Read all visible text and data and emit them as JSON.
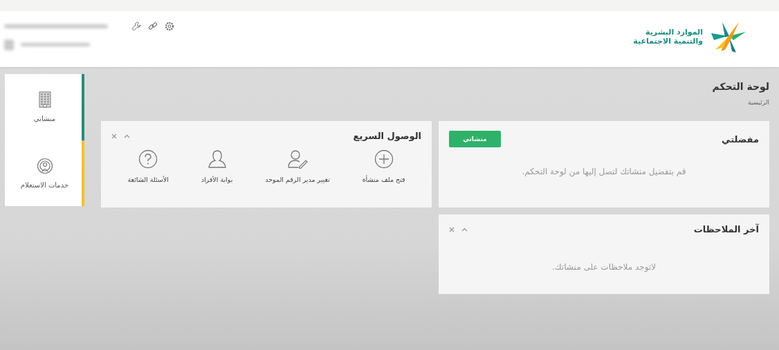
{
  "header": {
    "logo_lines": [
      "الموارد البشرية",
      "والتنمية الاجتماعية"
    ]
  },
  "sidebar": {
    "items": [
      {
        "label": "منشاتي",
        "kind": "building",
        "color": "#2a8a80"
      },
      {
        "label": "خدمات الاستعلام",
        "kind": "broadcast",
        "color": "#f2c230"
      }
    ]
  },
  "page": {
    "title": "لوحة التحكم",
    "breadcrumb": "الرئيسية"
  },
  "favorites": {
    "title": "مفضلتي",
    "button": "منشاتي",
    "empty_text": "قم بتفضيل منشاتك لتصل إليها من لوحة التحكم."
  },
  "notes": {
    "title": "آخر الملاحظات",
    "empty_text": "لاتوجد ملاحظات على منشاتك."
  },
  "quick_access": {
    "title": "الوصول السريع",
    "items": [
      {
        "label": "فتح ملف منشأة",
        "kind": "plus"
      },
      {
        "label": "تغيير مدير الرقم الموحد",
        "kind": "user-edit"
      },
      {
        "label": "بوابة الأفراد",
        "kind": "user"
      },
      {
        "label": "الأسئلة الشائعة",
        "kind": "question"
      }
    ]
  }
}
